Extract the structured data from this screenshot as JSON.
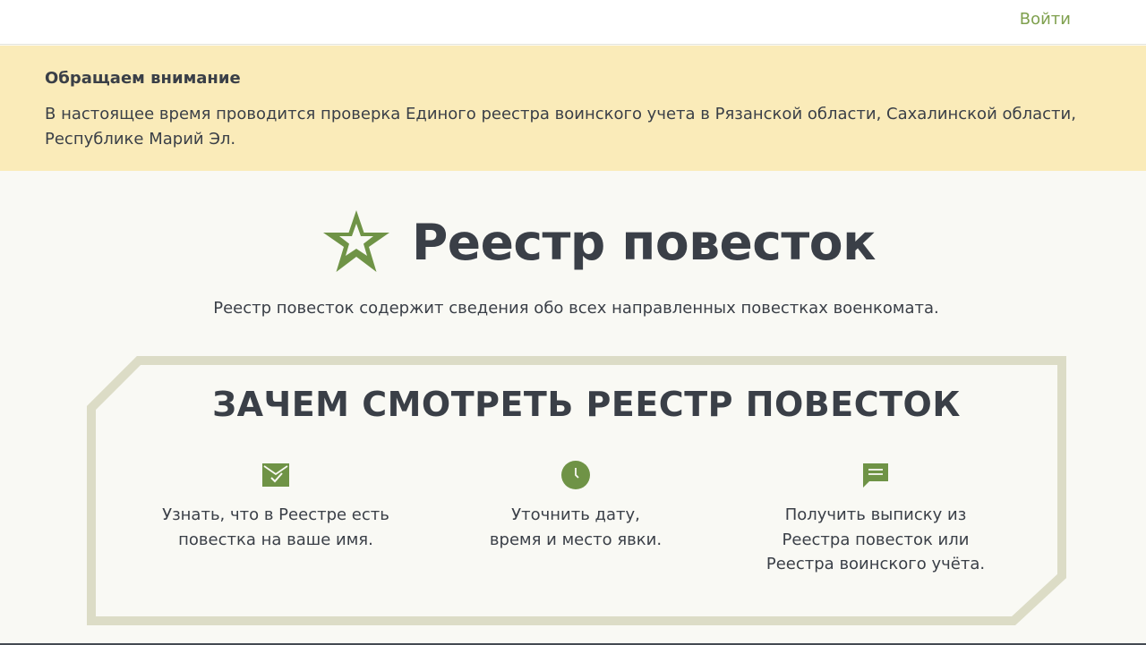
{
  "header": {
    "login_label": "Войти"
  },
  "notice": {
    "title": "Обращаем внимание",
    "text": "В настоящее время проводится проверка Единого реестра воинского учета в Рязанской области, Сахалинской области, Республике Марий Эл."
  },
  "hero": {
    "logo_icon": "star-icon",
    "title": "Реестр повесток",
    "subtitle": "Реестр повесток содержит сведения обо всех направленных повестках военкомата."
  },
  "why": {
    "title": "ЗАЧЕМ СМОТРЕТЬ РЕЕСТР ПОВЕСТОК",
    "features": [
      {
        "icon": "mail-check-icon",
        "text": "Узнать, что в Реестре есть\nповестка на ваше имя."
      },
      {
        "icon": "clock-icon",
        "text": "Уточнить дату,\nвремя и место явки."
      },
      {
        "icon": "message-icon",
        "text": "Получить выписку из\nРеестра повесток или\nРеестра воинского учёта."
      }
    ]
  },
  "colors": {
    "accent": "#7fa04e",
    "notice_bg": "#faebb9",
    "page_bg": "#f9f9f4",
    "frame": "#dcdcc6",
    "text": "#3a3f47"
  }
}
